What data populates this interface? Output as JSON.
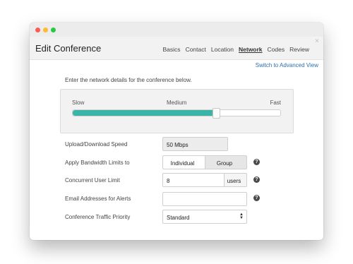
{
  "window": {
    "title": "Edit Conference",
    "close_glyph": "×",
    "tabs": [
      "Basics",
      "Contact",
      "Location",
      "Network",
      "Codes",
      "Review"
    ],
    "active_tab": "Network"
  },
  "advanced_link": "Switch to Advanced View",
  "intro": "Enter the network details for the conference below.",
  "slider": {
    "min_label": "Slow",
    "mid_label": "Medium",
    "max_label": "Fast",
    "value_fraction": 0.69,
    "fill_color": "#3ab4a6"
  },
  "form": {
    "speed": {
      "label": "Upload/Download Speed",
      "value": "50 Mbps"
    },
    "bandwidth": {
      "label": "Apply Bandwidth Limits to",
      "options": [
        "Individual",
        "Group"
      ],
      "selected": "Group",
      "help_icon": "?"
    },
    "users": {
      "label": "Concurrent User Limit",
      "value": "8",
      "addon": "users",
      "help_icon": "?"
    },
    "email": {
      "label": "Email Addresses for Alerts",
      "value": "",
      "help_icon": "?"
    },
    "priority": {
      "label": "Conference Traffic Priority",
      "value": "Standard"
    }
  },
  "icons": {
    "help": "help-icon",
    "close": "close-icon",
    "select_arrows": "select-arrows-icon"
  },
  "colors": {
    "accent": "#3ab4a6",
    "link": "#2a6fb0",
    "traffic_red": "#fc5e57",
    "traffic_yellow": "#fdbb2f",
    "traffic_green": "#28c840"
  }
}
